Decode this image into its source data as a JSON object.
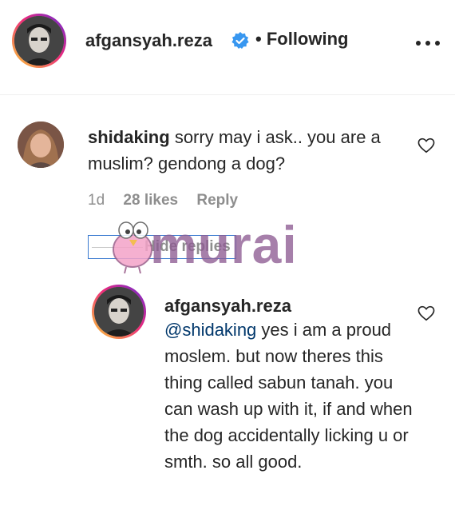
{
  "header": {
    "username": "afgansyah.reza",
    "separator": "•",
    "follow_status": "Following"
  },
  "comment": {
    "username": "shidaking",
    "text": "sorry may i ask.. you are a muslim? gendong a dog?",
    "age": "1d",
    "likes": "28 likes",
    "reply_label": "Reply",
    "hide_replies_label": "Hide replies"
  },
  "reply": {
    "username": "afgansyah.reza",
    "mention": "@shidaking",
    "text": " yes i am a proud moslem. but now theres this thing called sabun tanah. you can wash up with it, if and when the dog accidentally licking u or smth. so all good."
  },
  "watermark": {
    "text": "murai"
  },
  "colors": {
    "verified": "#3897f0",
    "mention": "#00376b",
    "muted": "#8e8e8e",
    "watermark": "#8e5c93"
  },
  "icons": [
    "verified-badge-icon",
    "more-options-icon",
    "heart-icon",
    "bird-mascot-icon"
  ]
}
